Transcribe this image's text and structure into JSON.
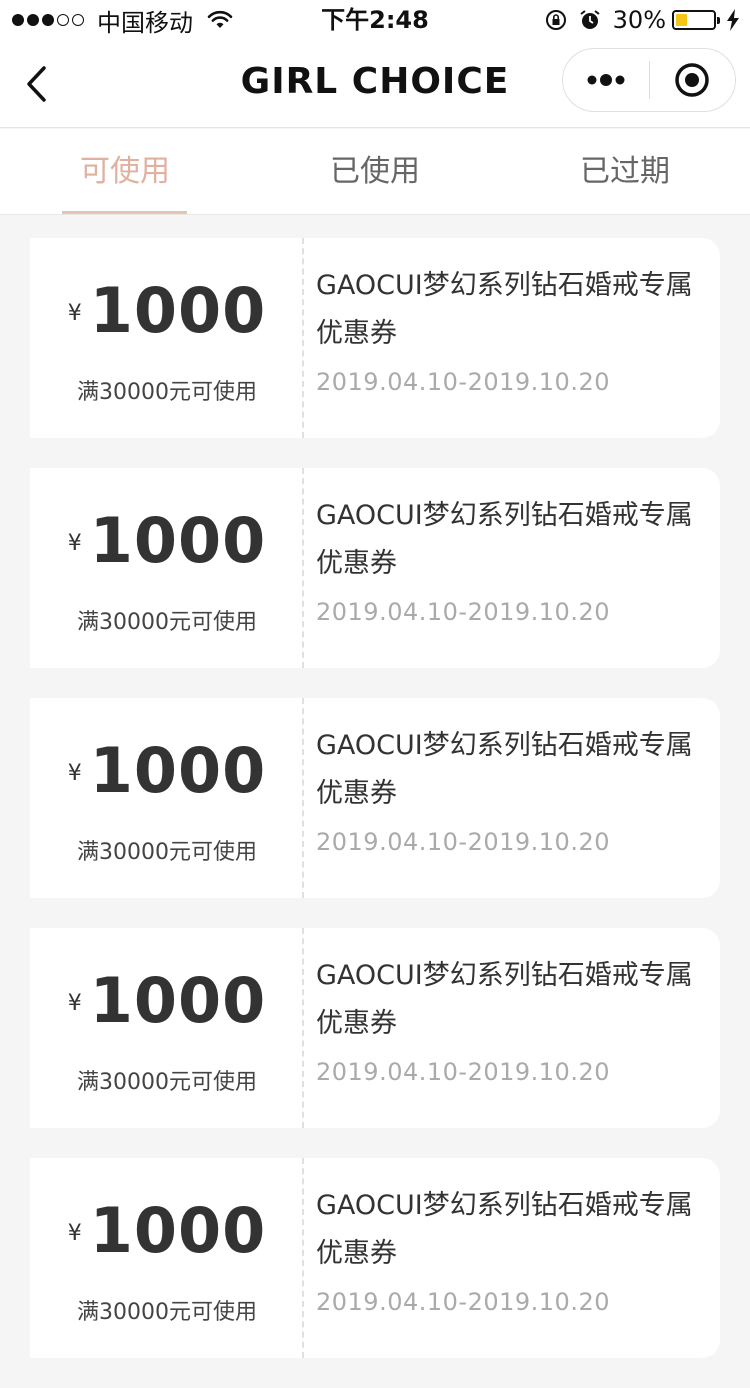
{
  "status_bar": {
    "carrier": "中国移动",
    "time": "下午2:48",
    "battery_percent": "30%",
    "battery_level": 0.3,
    "signal_strength": 3,
    "signal_total": 5
  },
  "nav": {
    "title": "GIRL CHOICE",
    "back_icon": "chevron-left-icon",
    "more_icon": "more-dots-icon",
    "close_icon": "target-close-icon"
  },
  "tabs": [
    {
      "label": "可使用",
      "active": true
    },
    {
      "label": "已使用",
      "active": false
    },
    {
      "label": "已过期",
      "active": false
    }
  ],
  "colors": {
    "accent": "#e0b0a0",
    "background": "#f5f5f5",
    "battery": "#f5c518"
  },
  "coupons": [
    {
      "currency": "¥",
      "amount": "1000",
      "condition": "满30000元可使用",
      "title": "GAOCUI梦幻系列钻石婚戒专属优惠券",
      "date": "2019.04.10-2019.10.20"
    },
    {
      "currency": "¥",
      "amount": "1000",
      "condition": "满30000元可使用",
      "title": "GAOCUI梦幻系列钻石婚戒专属优惠券",
      "date": "2019.04.10-2019.10.20"
    },
    {
      "currency": "¥",
      "amount": "1000",
      "condition": "满30000元可使用",
      "title": "GAOCUI梦幻系列钻石婚戒专属优惠券",
      "date": "2019.04.10-2019.10.20"
    },
    {
      "currency": "¥",
      "amount": "1000",
      "condition": "满30000元可使用",
      "title": "GAOCUI梦幻系列钻石婚戒专属优惠券",
      "date": "2019.04.10-2019.10.20"
    },
    {
      "currency": "¥",
      "amount": "1000",
      "condition": "满30000元可使用",
      "title": "GAOCUI梦幻系列钻石婚戒专属优惠券",
      "date": "2019.04.10-2019.10.20"
    }
  ]
}
